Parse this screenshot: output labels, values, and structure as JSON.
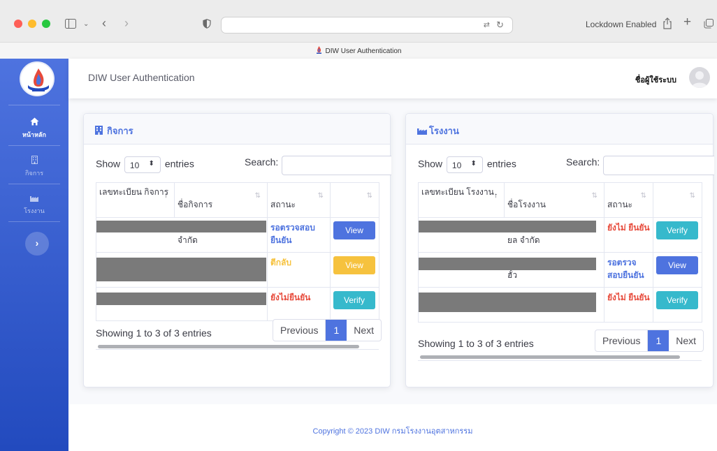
{
  "browser": {
    "tab_title": "DIW User Authentication",
    "lockdown_label": "Lockdown Enabled"
  },
  "sidebar": {
    "items": [
      {
        "label": "หน้าหลัก",
        "icon": "home-icon"
      },
      {
        "label": "กิจการ",
        "icon": "building-icon"
      },
      {
        "label": "โรงงาน",
        "icon": "industry-icon"
      }
    ],
    "toggle_glyph": "›"
  },
  "topbar": {
    "app_title": "DIW User Authentication",
    "username": "ชื่อผู้ใช้ระบบ"
  },
  "business_card": {
    "title": "กิจการ",
    "show_label": "Show",
    "entries_value": "10",
    "entries_label": "entries",
    "search_label": "Search:",
    "columns": [
      "เลขทะเบียน กิจการ",
      "ชื่อกิจการ",
      "สถานะ",
      ""
    ],
    "rows": [
      {
        "name_tail": "จำกัด",
        "status": "รอตรวจสอบ ยืนยัน",
        "status_color": "#4e73df",
        "action": "View"
      },
      {
        "name_tail": "",
        "status": "ตีกลับ",
        "status_color": "#f6c23e",
        "action": "View"
      },
      {
        "name_tail": "",
        "status": "ยังไม่ยืนยัน",
        "status_color": "#e74a3b",
        "action": "Verify"
      }
    ],
    "info": "Showing 1 to 3 of 3 entries",
    "pager": {
      "previous": "Previous",
      "current": "1",
      "next": "Next"
    }
  },
  "factory_card": {
    "title": "โรงงาน",
    "show_label": "Show",
    "entries_value": "10",
    "entries_label": "entries",
    "search_label": "Search:",
    "columns": [
      "เลขทะเบียน โรงงาน",
      "ชื่อโรงงาน",
      "สถานะ",
      ""
    ],
    "rows": [
      {
        "name_tail": "ยล จำกัด",
        "status": "ยังไม่ ยืนยัน",
        "status_color": "#e74a3b",
        "action": "Verify"
      },
      {
        "name_tail": "ฮั้ว",
        "status": "รอตรวจ สอบยืนยัน",
        "status_color": "#4e73df",
        "action": "View"
      },
      {
        "name_tail": "",
        "status": "ยังไม่ ยืนยัน",
        "status_color": "#e74a3b",
        "action": "Verify"
      }
    ],
    "info": "Showing 1 to 3 of 3 entries",
    "pager": {
      "previous": "Previous",
      "current": "1",
      "next": "Next"
    }
  },
  "footer": {
    "copyright": "Copyright © 2023 DIW กรมโรงงานอุตสาหกรรม"
  }
}
